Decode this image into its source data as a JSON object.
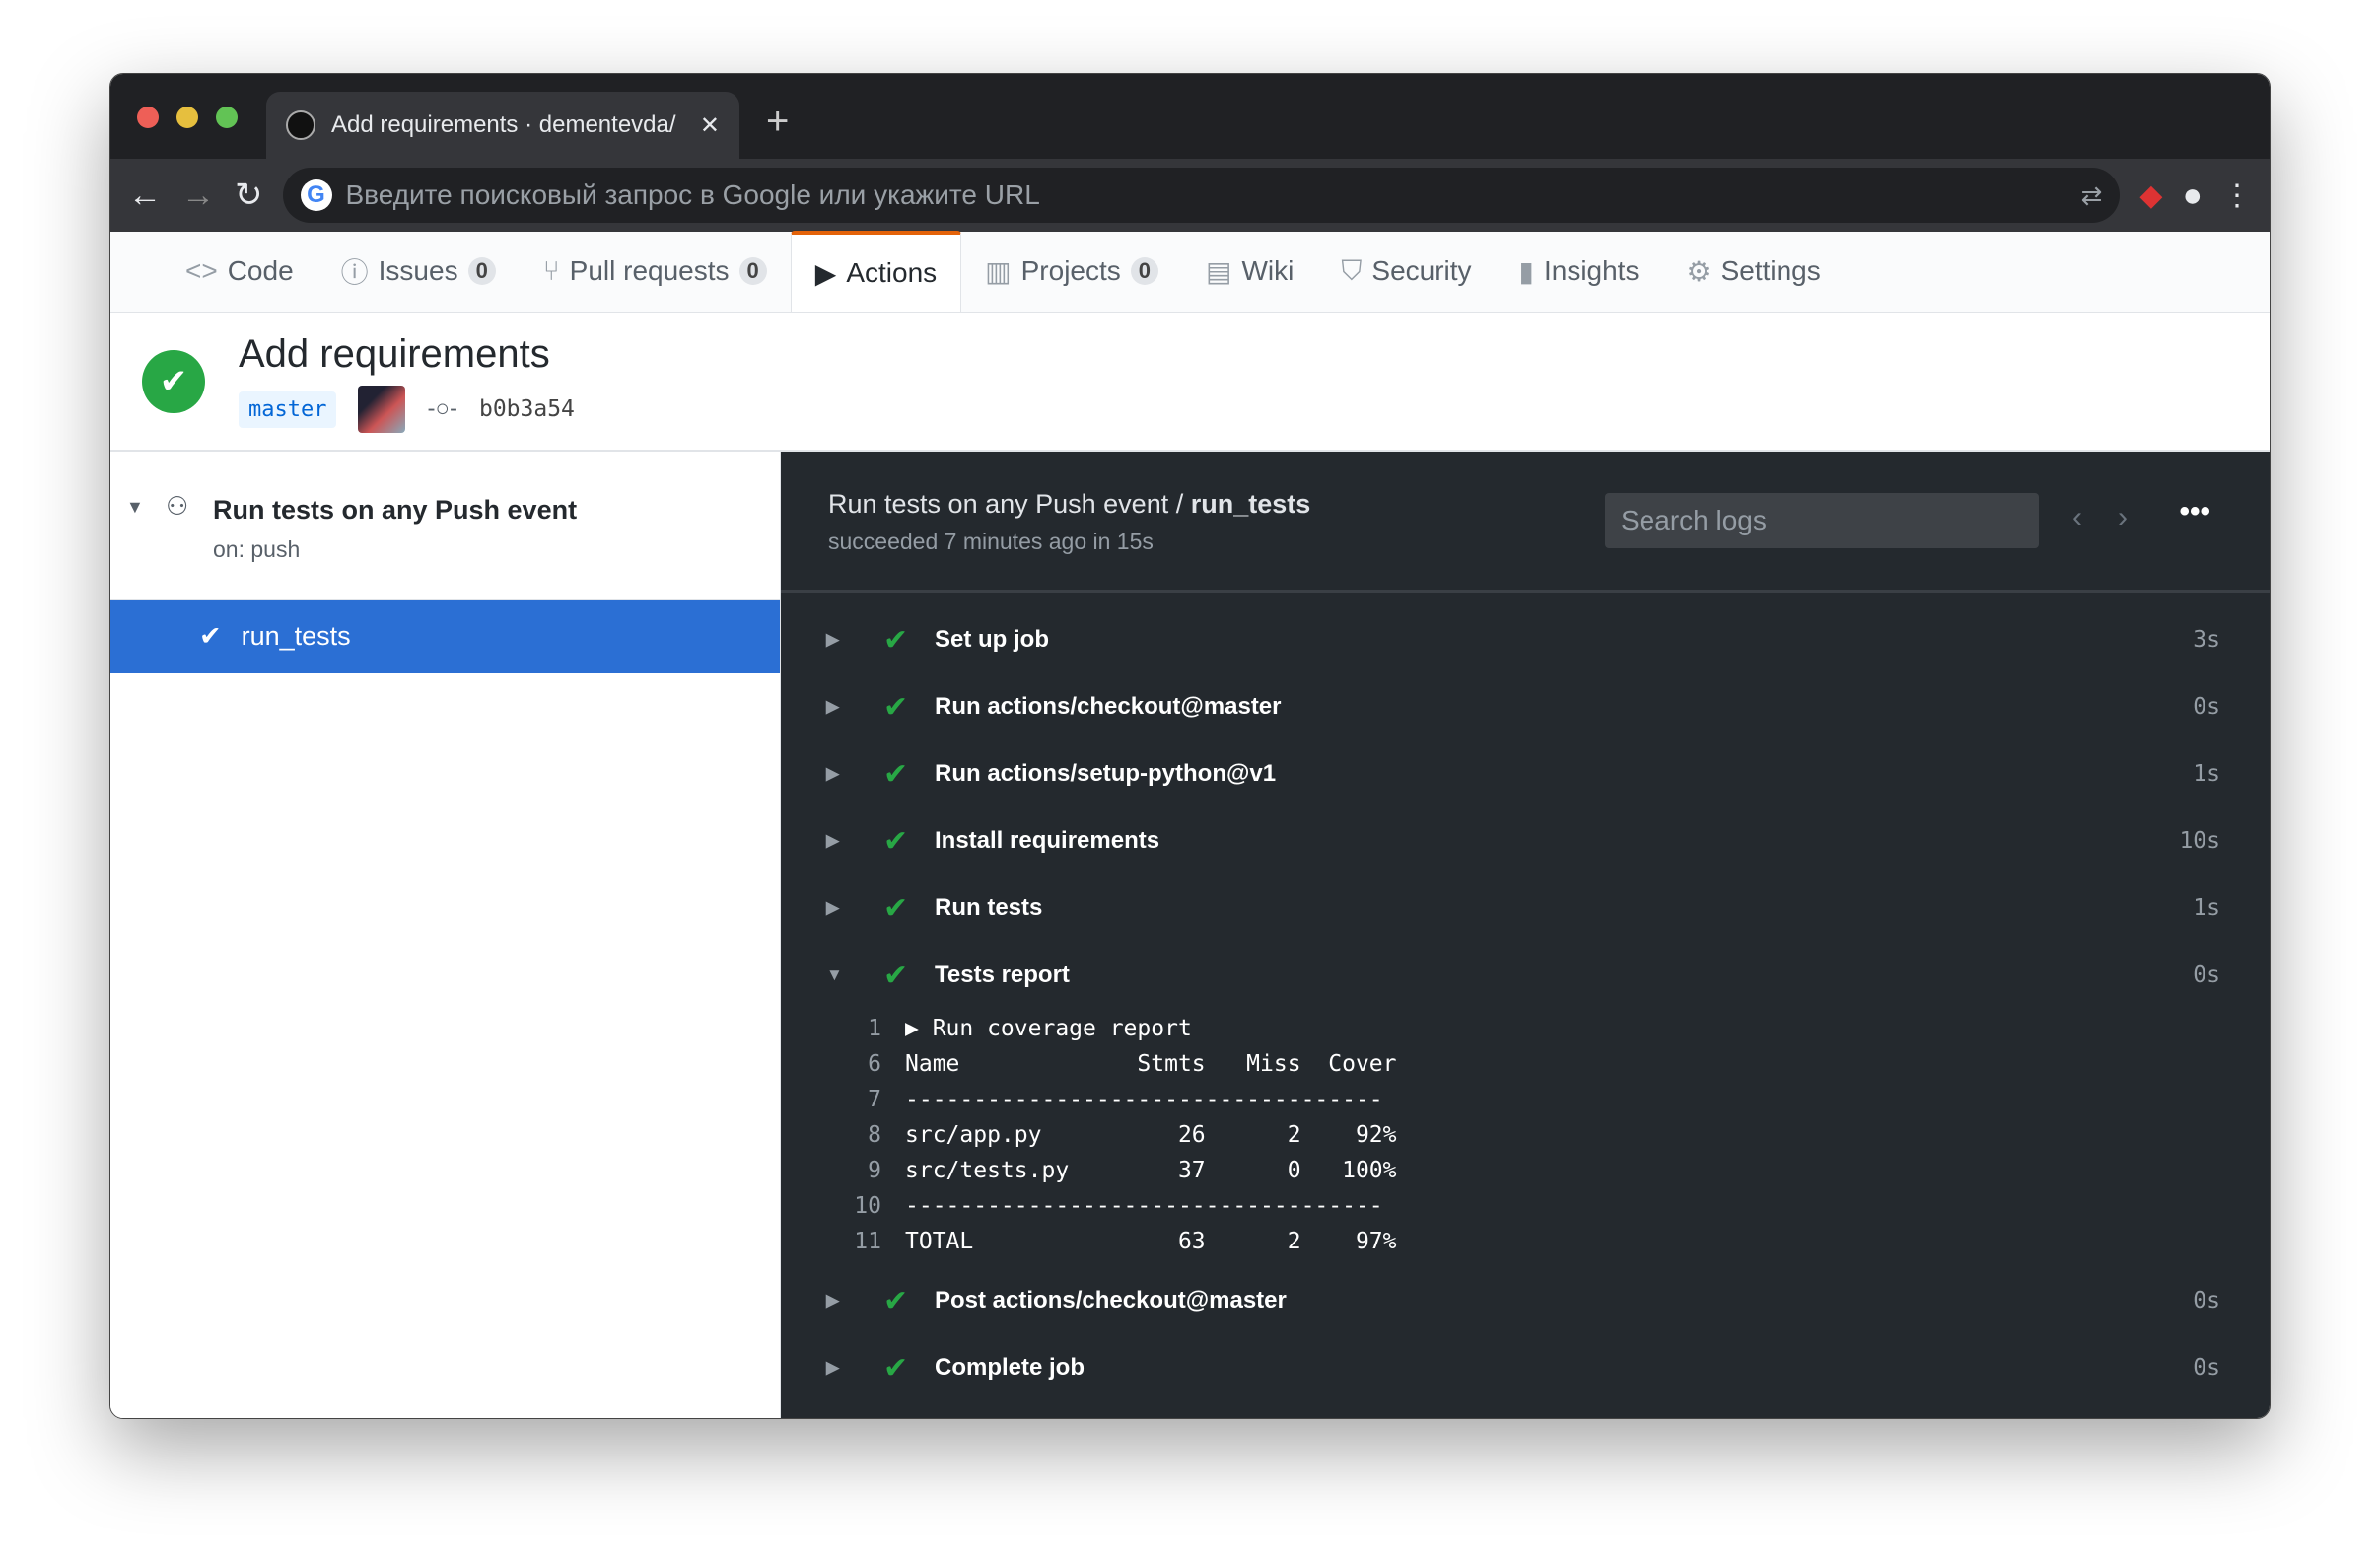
{
  "browser": {
    "tab_title": "Add requirements · dementevda/",
    "omnibox_placeholder": "Введите поисковый запрос в Google или укажите URL",
    "new_tab": "+",
    "close": "✕"
  },
  "reponav": [
    {
      "label": "Code",
      "icon": "code-icon",
      "glyph": "<>"
    },
    {
      "label": "Issues",
      "count": "0",
      "icon": "issue-icon",
      "glyph": "ⓘ"
    },
    {
      "label": "Pull requests",
      "count": "0",
      "icon": "pull-request-icon",
      "glyph": "⑂"
    },
    {
      "label": "Actions",
      "icon": "play-icon",
      "glyph": "▶"
    },
    {
      "label": "Projects",
      "count": "0",
      "icon": "project-icon",
      "glyph": "▥"
    },
    {
      "label": "Wiki",
      "icon": "book-icon",
      "glyph": "▤"
    },
    {
      "label": "Security",
      "icon": "shield-icon",
      "glyph": "⛉"
    },
    {
      "label": "Insights",
      "icon": "graph-icon",
      "glyph": "▮"
    },
    {
      "label": "Settings",
      "icon": "gear-icon",
      "glyph": "⚙"
    }
  ],
  "run": {
    "title": "Add requirements",
    "branch": "master",
    "sha": "b0b3a54"
  },
  "workflow": {
    "name": "Run tests on any Push event",
    "trigger": "on: push",
    "job": "run_tests"
  },
  "log_header": {
    "workflow": "Run tests on any Push event / ",
    "job": "run_tests",
    "status": "succeeded 7 minutes ago in 15s",
    "search_placeholder": "Search logs"
  },
  "steps_before": [
    {
      "name": "Set up job",
      "dur": "3s"
    },
    {
      "name": "Run actions/checkout@master",
      "dur": "0s"
    },
    {
      "name": "Run actions/setup-python@v1",
      "dur": "1s"
    },
    {
      "name": "Install requirements",
      "dur": "10s"
    },
    {
      "name": "Run tests",
      "dur": "1s"
    },
    {
      "name": "Tests report",
      "dur": "0s"
    }
  ],
  "log_lines": [
    {
      "n": "1",
      "t": "▶ Run coverage report"
    },
    {
      "n": "6",
      "t": "Name             Stmts   Miss  Cover"
    },
    {
      "n": "7",
      "t": "-----------------------------------"
    },
    {
      "n": "8",
      "t": "src/app.py          26      2    92%"
    },
    {
      "n": "9",
      "t": "src/tests.py        37      0   100%"
    },
    {
      "n": "10",
      "t": "-----------------------------------"
    },
    {
      "n": "11",
      "t": "TOTAL               63      2    97%"
    }
  ],
  "steps_after": [
    {
      "name": "Post actions/checkout@master",
      "dur": "0s"
    },
    {
      "name": "Complete job",
      "dur": "0s"
    }
  ],
  "colors": {
    "accent": "#e36209",
    "success": "#28a745",
    "selected": "#2b6fd4"
  }
}
